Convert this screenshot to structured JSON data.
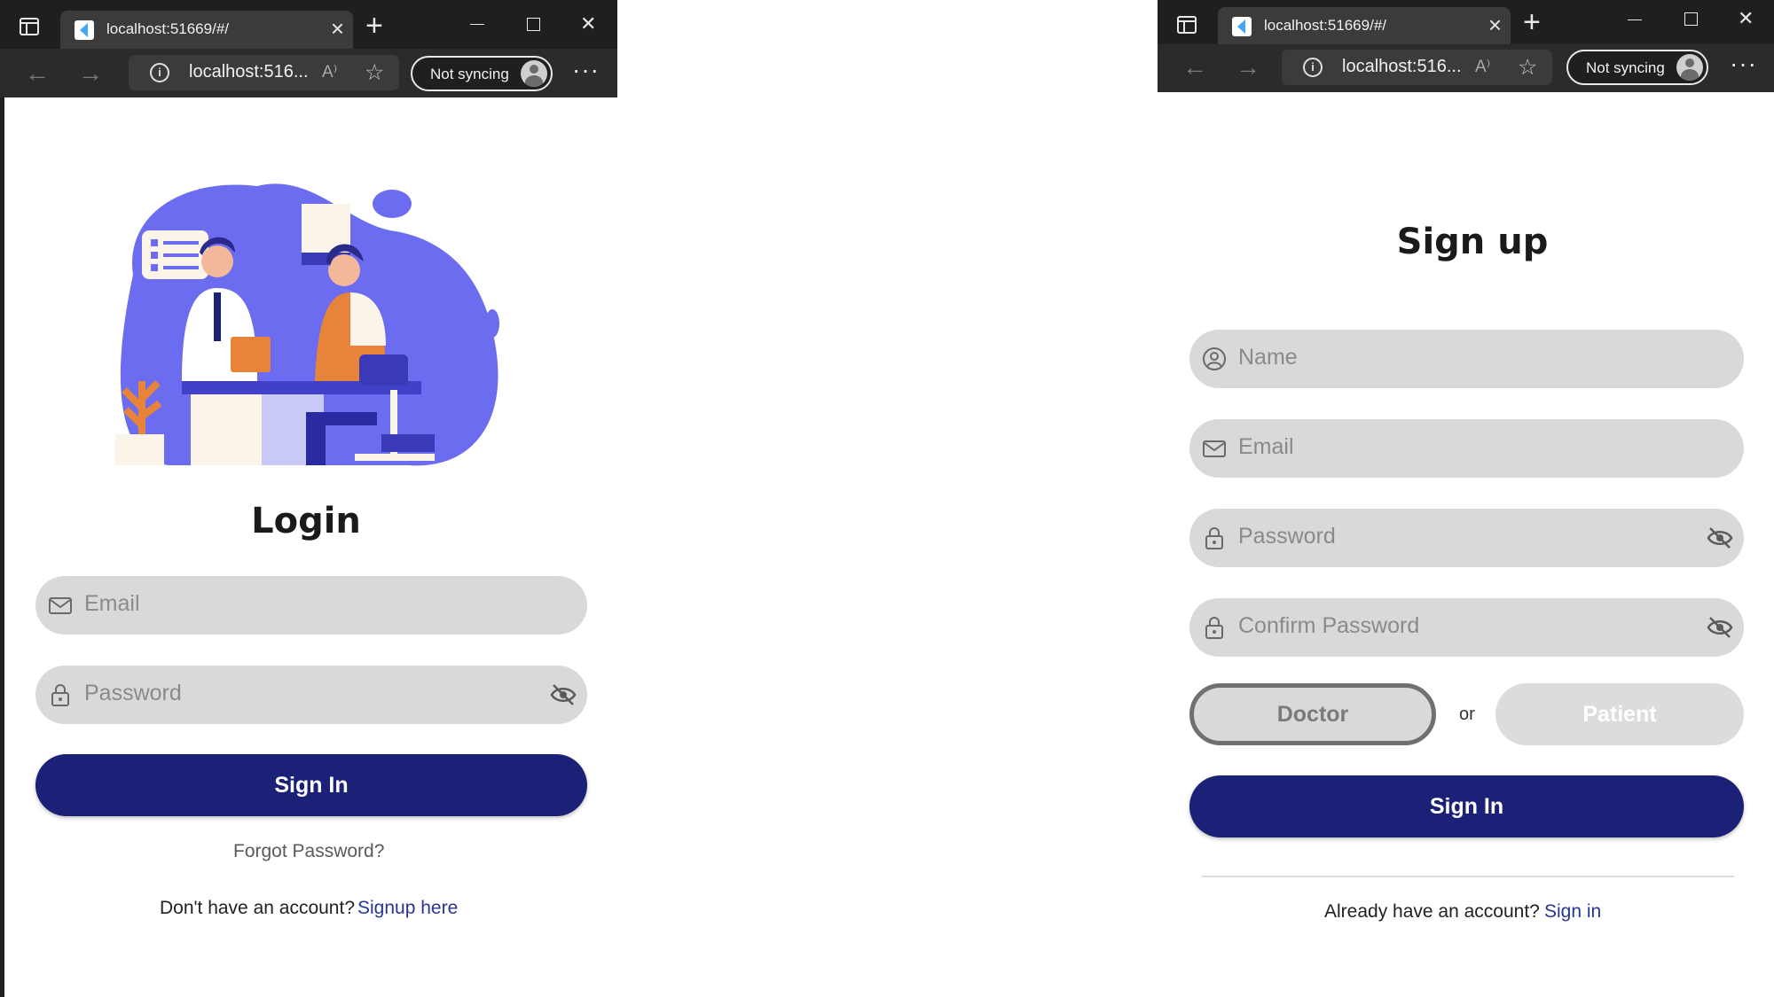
{
  "browser": {
    "tab_title": "localhost:51669/#/",
    "url": "localhost:516...",
    "sync_label": "Not syncing",
    "new_tab_glyph": "+",
    "close_glyph": "×",
    "more_glyph": "···",
    "read_aloud_glyph": "A⁾",
    "favorite_glyph": "☆",
    "info_glyph": "i",
    "back_glyph": "←",
    "forward_glyph": "→",
    "window_close_glyph": "✕"
  },
  "login": {
    "title": "Login",
    "email_placeholder": "Email",
    "password_placeholder": "Password",
    "sign_in_label": "Sign In",
    "forgot_password": "Forgot Password?",
    "no_account_text": "Don't have an account?",
    "signup_link": "Signup here",
    "illustration": "doctor-consultation-illustration"
  },
  "signup": {
    "title": "Sign up",
    "name_placeholder": "Name",
    "email_placeholder": "Email",
    "password_placeholder": "Password",
    "confirm_password_placeholder": "Confirm Password",
    "role_doctor": "Doctor",
    "role_or": "or",
    "role_patient": "Patient",
    "selected_role": "Doctor",
    "sign_in_label": "Sign In",
    "have_account_text": "Already have an account?",
    "signin_link": "Sign in"
  },
  "colors": {
    "primary": "#1a2176",
    "link": "#283593",
    "field_bg": "#d9d9d9",
    "illustration_accent": "#6c6cf0",
    "illustration_orange": "#e8833a"
  },
  "icons": [
    "tab-actions-icon",
    "flutter-favicon",
    "close-icon",
    "plus-icon",
    "minimize-icon",
    "maximize-icon",
    "back-icon",
    "forward-icon",
    "info-icon",
    "read-aloud-icon",
    "favorite-icon",
    "avatar-icon",
    "more-icon",
    "mail-icon",
    "lock-icon",
    "eye-off-icon",
    "user-circle-icon"
  ]
}
